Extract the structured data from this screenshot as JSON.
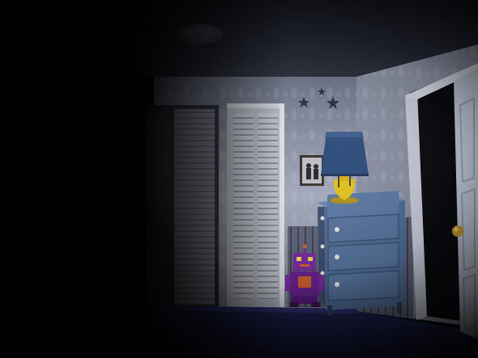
{
  "scene": {
    "colors": {
      "carpet": "#2b2f6a",
      "wall": "#8f96aa",
      "wainscot": "#5c6075",
      "closet_door": "#c9ccd6",
      "dresser": "#4f6a93",
      "lamp_shade": "#2c4a78",
      "lamp_base": "#e0c020",
      "door": "#c0c8d8",
      "door_knob": "#c89a30",
      "robot": "#7a2aa0",
      "robot_accent": "#d06030",
      "stars": "#2a2e40"
    },
    "objects": {
      "ceiling_light": "ceiling-light",
      "closet": "closet-doors",
      "dresser": "dresser",
      "lamp": "lamp",
      "picture_frame": "picture-frame",
      "wall_stars": "wall-stars",
      "hallway_door": "hallway-door",
      "toy": "robot-toy"
    }
  }
}
